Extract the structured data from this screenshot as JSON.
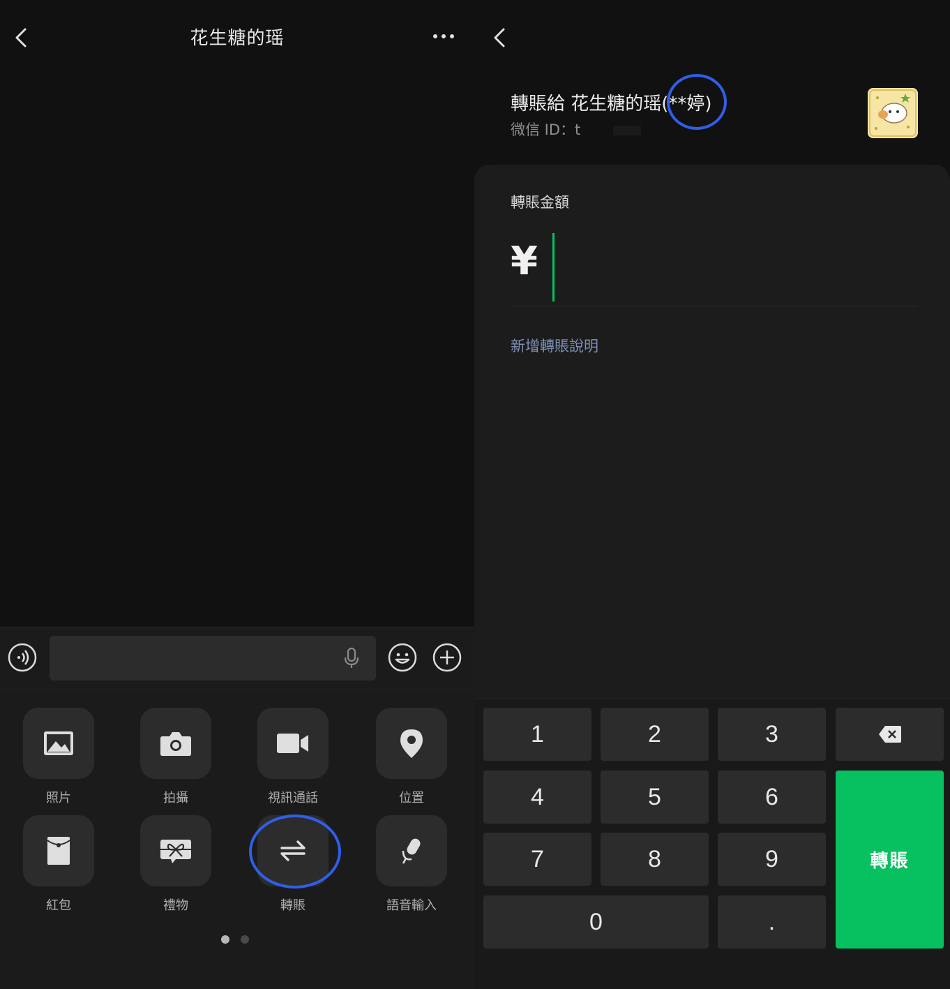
{
  "chat": {
    "title": "花生糖的瑶",
    "input_placeholder": "",
    "actions": [
      {
        "label": "照片",
        "icon": "photo-icon"
      },
      {
        "label": "拍攝",
        "icon": "camera-icon"
      },
      {
        "label": "視訊通話",
        "icon": "video-call-icon"
      },
      {
        "label": "位置",
        "icon": "location-icon"
      },
      {
        "label": "紅包",
        "icon": "red-packet-icon"
      },
      {
        "label": "禮物",
        "icon": "gift-icon"
      },
      {
        "label": "轉賬",
        "icon": "transfer-icon"
      },
      {
        "label": "語音輸入",
        "icon": "voice-input-icon"
      }
    ],
    "page_indicator": {
      "current": 1,
      "total": 2
    }
  },
  "transfer": {
    "recipient_prefix": "轉賬給 花生糖的瑶",
    "recipient_realname": "(**婷)",
    "wechat_id_label": "微信 ID：t",
    "amount_label": "轉賬金額",
    "currency_symbol": "¥",
    "amount_value": "",
    "add_note_link": "新增轉賬說明",
    "keys": [
      "1",
      "2",
      "3",
      "4",
      "5",
      "6",
      "7",
      "8",
      "9",
      "0",
      "."
    ],
    "transfer_button": "轉賬"
  },
  "colors": {
    "accent_green": "#07c160",
    "annotation_ring": "#2f5fe8",
    "link_blue_grey": "#7d90b4"
  }
}
